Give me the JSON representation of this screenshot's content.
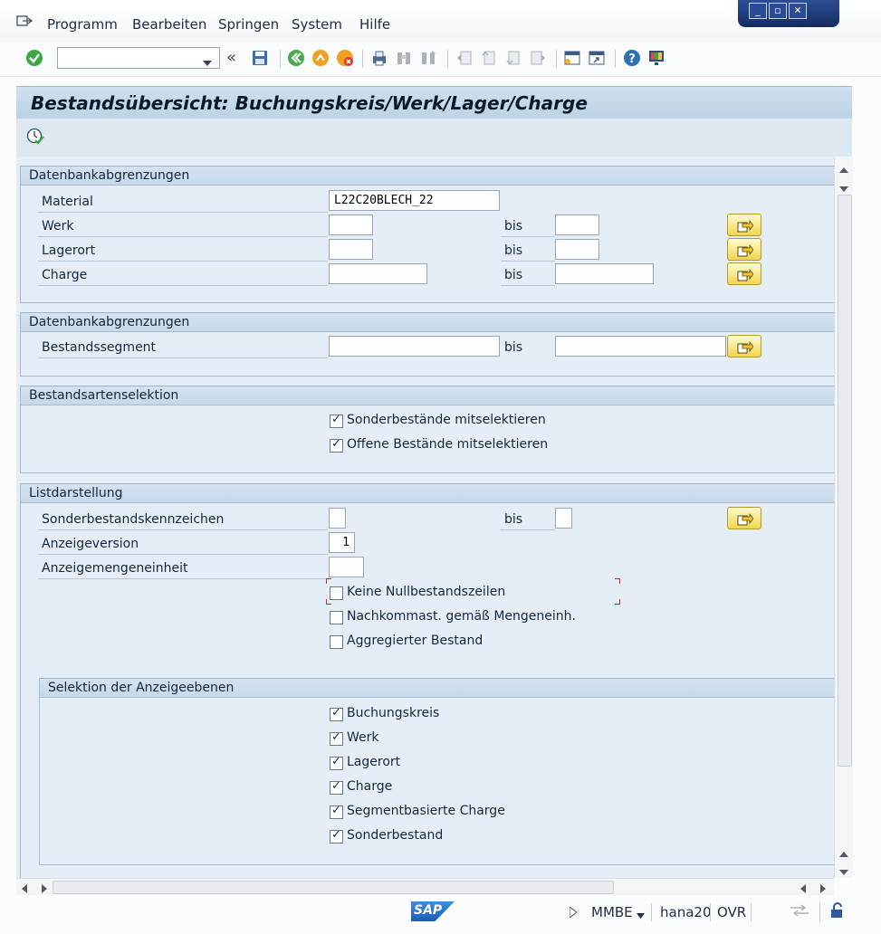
{
  "menu": {
    "items": [
      {
        "label": "Programm"
      },
      {
        "label": "Bearbeiten"
      },
      {
        "label": "Springen"
      },
      {
        "label": "System"
      },
      {
        "label": "Hilfe"
      }
    ]
  },
  "toolbar": {
    "command_field_value": "",
    "icons": [
      "enter-check-icon",
      "back-nav-icon",
      "save-icon",
      "back-icon",
      "exit-icon",
      "cancel-icon",
      "print-icon",
      "find-icon",
      "find-next-icon",
      "first-page-icon",
      "previous-page-icon",
      "next-page-icon",
      "last-page-icon",
      "create-session-icon",
      "create-shortcut-icon",
      "help-icon",
      "customize-layout-icon"
    ]
  },
  "title": {
    "text": "Bestandsübersicht: Buchungskreis/Werk/Lager/Charge"
  },
  "app_toolbar": {
    "icons": [
      "execute-icon"
    ]
  },
  "groups": {
    "db1": {
      "title": "Datenbankabgrenzungen",
      "material_label": "Material",
      "material_value": "L22C20BLECH_22",
      "werk_label": "Werk",
      "lagerort_label": "Lagerort",
      "charge_label": "Charge",
      "bis_label": "bis"
    },
    "db2": {
      "title": "Datenbankabgrenzungen",
      "segment_label": "Bestandssegment",
      "bis_label": "bis"
    },
    "stock": {
      "title": "Bestandsartenselektion",
      "options": [
        {
          "label": "Sonderbestände mitselektieren",
          "checked": true
        },
        {
          "label": "Offene Bestände mitselektieren",
          "checked": true
        }
      ]
    },
    "list": {
      "title": "Listdarstellung",
      "special_stock_label": "Sonderbestandskennzeichen",
      "bis_label": "bis",
      "display_version_label": "Anzeigeversion",
      "display_version_value": "1",
      "unit_label": "Anzeigemengeneinheit",
      "options": [
        {
          "label": "Keine Nullbestandszeilen",
          "checked": false
        },
        {
          "label": "Nachkommast. gemäß Mengeneinh.",
          "checked": false
        },
        {
          "label": "Aggregierter Bestand",
          "checked": false
        }
      ]
    },
    "levels": {
      "title": "Selektion der Anzeigeebenen",
      "options": [
        {
          "label": "Buchungskreis",
          "checked": true
        },
        {
          "label": "Werk",
          "checked": true
        },
        {
          "label": "Lagerort",
          "checked": true
        },
        {
          "label": "Charge",
          "checked": true
        },
        {
          "label": "Segmentbasierte Charge",
          "checked": true
        },
        {
          "label": "Sonderbestand",
          "checked": true
        }
      ]
    }
  },
  "status": {
    "logo": "SAP",
    "transaction": "MMBE",
    "server": "hana20",
    "mode": "OVR"
  }
}
